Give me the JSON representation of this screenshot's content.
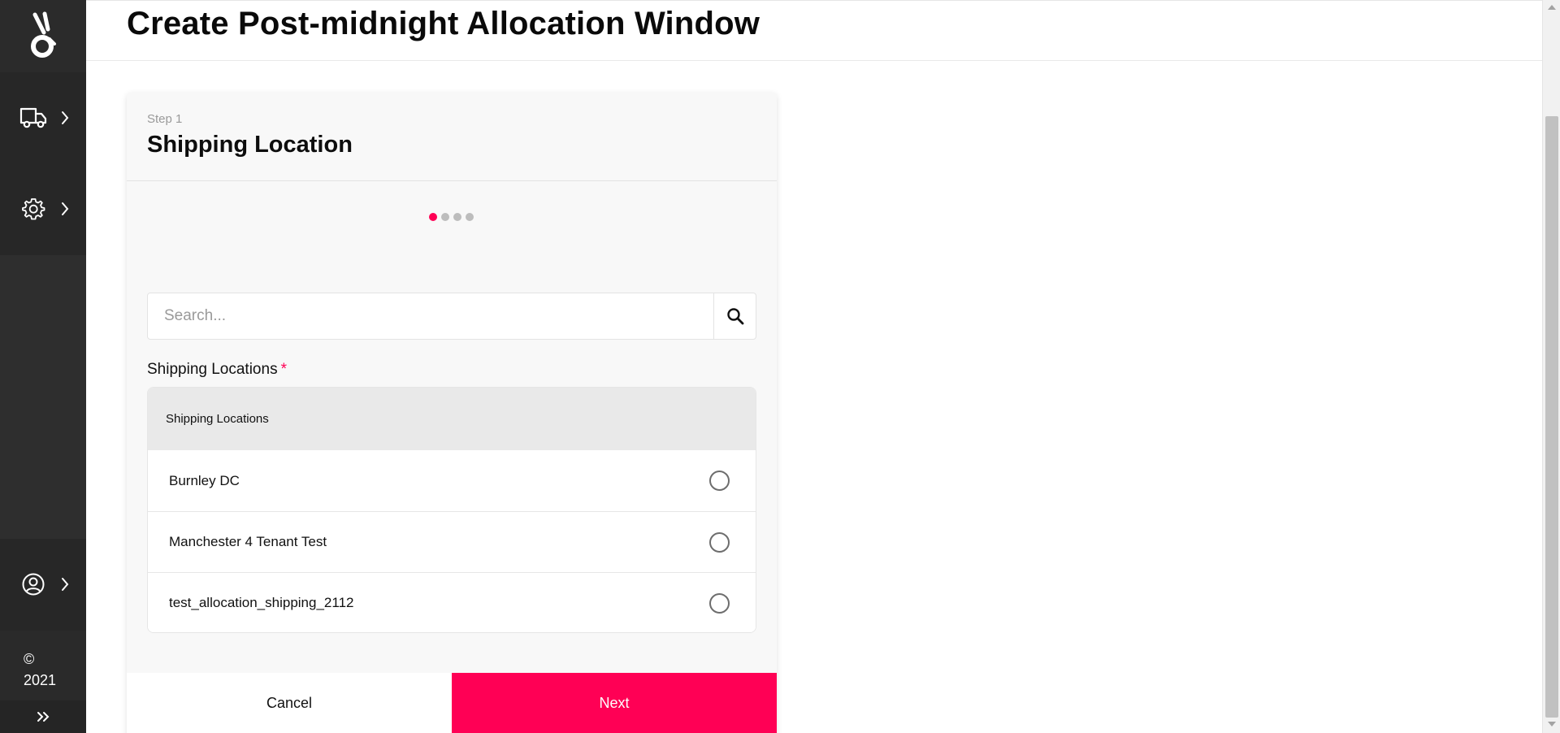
{
  "header": {
    "title": "Create Post-midnight Allocation Window"
  },
  "sidebar": {
    "logo_icon": "brand-logo-icon",
    "items": [
      {
        "icon": "truck-icon"
      },
      {
        "icon": "gear-icon"
      },
      {
        "icon": "user-icon"
      }
    ],
    "copyright_symbol": "©",
    "copyright_year": "2021"
  },
  "card": {
    "step_label": "Step 1",
    "title": "Shipping Location",
    "progress": {
      "total_steps": 4,
      "current_step": 1
    },
    "search": {
      "placeholder": "Search...",
      "value": ""
    },
    "field_label": "Shipping Locations",
    "required_marker": "*",
    "list_header": "Shipping Locations",
    "locations": [
      {
        "name": "Burnley DC",
        "selected": false
      },
      {
        "name": "Manchester 4 Tenant Test",
        "selected": false
      },
      {
        "name": "test_allocation_shipping_2112",
        "selected": false
      }
    ],
    "cancel_label": "Cancel",
    "next_label": "Next"
  },
  "colors": {
    "accent": "#ff0055",
    "sidebar": "#2e2e2e"
  }
}
